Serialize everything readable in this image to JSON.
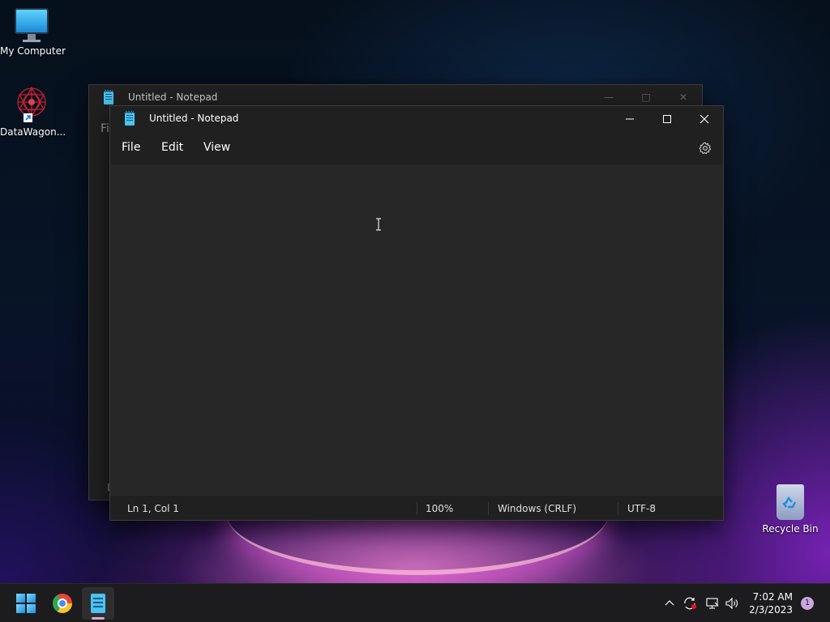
{
  "desktop": {
    "icons": [
      {
        "label": "My Computer",
        "icon": "monitor-icon"
      },
      {
        "label": "DataWagon...",
        "icon": "datawagon-icon"
      },
      {
        "label": "Recycle Bin",
        "icon": "recycle-bin-icon"
      }
    ]
  },
  "background_window": {
    "title": "Untitled - Notepad",
    "menu_stub": "Fi",
    "status_stub": "L"
  },
  "notepad": {
    "title": "Untitled - Notepad",
    "menu": [
      "File",
      "Edit",
      "View"
    ],
    "content": "",
    "status": {
      "position": "Ln 1, Col 1",
      "zoom": "100%",
      "line_ending": "Windows (CRLF)",
      "encoding": "UTF-8"
    }
  },
  "taskbar": {
    "apps": [
      "start-icon",
      "chrome-icon",
      "notepad-icon"
    ],
    "clock": {
      "time": "7:02 AM",
      "date": "2/3/2023"
    },
    "notification_count": "1"
  },
  "colors": {
    "window_bg": "#272727",
    "titlebar_bg": "#202020",
    "taskbar_bg": "#1c1c1e",
    "accent": "#4cc2f0"
  }
}
